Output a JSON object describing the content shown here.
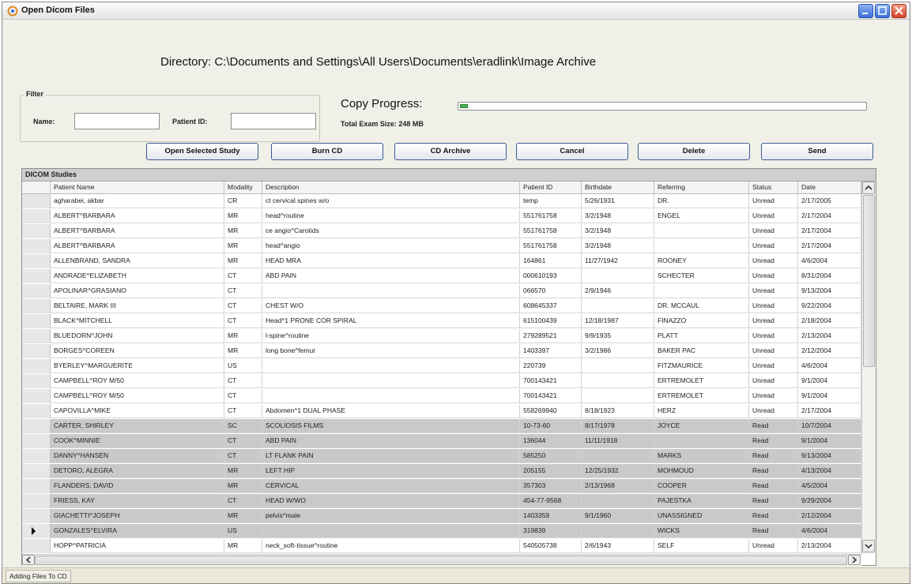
{
  "window": {
    "title": "Open Dicom Files"
  },
  "directory_text": "Directory: C:\\Documents and Settings\\All Users\\Documents\\eradlink\\Image Archive",
  "filter": {
    "legend": "Filter",
    "name_label": "Name:",
    "name_value": "",
    "patient_id_label": "Patient ID:",
    "patient_id_value": ""
  },
  "copy": {
    "label": "Copy Progress:",
    "progress": 0.01,
    "total_size": "Total Exam Size:  248 MB"
  },
  "buttons": [
    "Open Selected Study",
    "Burn CD",
    "CD Archive",
    "Cancel",
    "Delete",
    "Send"
  ],
  "table": {
    "title": "DICOM Studies",
    "columns": [
      "Patient Name",
      "Modality",
      "Description",
      "Patient ID",
      "Birthdate",
      "Referring",
      "Status",
      "Date"
    ],
    "rows": [
      [
        "agharabei, akbar",
        "CR",
        "ct cervical spines w/o",
        "temp",
        "5/26/1931",
        "DR.",
        "Unread",
        "2/17/2005",
        "unread"
      ],
      [
        "ALBERT^BARBARA",
        "MR",
        "head^routine",
        "551761758",
        "3/2/1948",
        "ENGEL",
        "Unread",
        "2/17/2004",
        "unread"
      ],
      [
        "ALBERT^BARBARA",
        "MR",
        "ce angio^Carotids",
        "551761758",
        "3/2/1948",
        "",
        "Unread",
        "2/17/2004",
        "unread"
      ],
      [
        "ALBERT^BARBARA",
        "MR",
        "head^angio",
        "551761758",
        "3/2/1948",
        "",
        "Unread",
        "2/17/2004",
        "unread"
      ],
      [
        "ALLENBRAND, SANDRA",
        "MR",
        "HEAD MRA",
        "164861",
        "11/27/1942",
        "ROONEY",
        "Unread",
        "4/6/2004",
        "unread"
      ],
      [
        "ANDRADE^ELIZABETH",
        "CT",
        "ABD PAIN",
        "000610193",
        "",
        "SCHECTER",
        "Unread",
        "8/31/2004",
        "unread"
      ],
      [
        "APOLINAR^GRASIANO",
        "CT",
        "",
        "066570",
        "2/9/1946",
        "",
        "Unread",
        "9/13/2004",
        "unread"
      ],
      [
        "BELTAIRE, MARK III",
        "CT",
        "CHEST W/O",
        "608645337",
        "",
        "DR. MCCAUL",
        "Unread",
        "9/22/2004",
        "unread"
      ],
      [
        "BLACK^MITCHELL",
        "CT",
        "Head^1 PRONE COR SPIRAL",
        "615100439",
        "12/18/1987",
        "FINAZZO",
        "Unread",
        "2/18/2004",
        "unread"
      ],
      [
        "BLUEDORN^JOHN",
        "MR",
        "l-spine^routine",
        "279289521",
        "9/9/1935",
        "PLATT",
        "Unread",
        "2/13/2004",
        "unread"
      ],
      [
        "BORGES^COREEN",
        "MR",
        "long bone^femur",
        "1403397",
        "3/2/1986",
        "BAKER PAC",
        "Unread",
        "2/12/2004",
        "unread"
      ],
      [
        "BYERLEY^MARGUERITE",
        "US",
        "",
        "220739",
        "",
        "FITZMAURICE",
        "Unread",
        "4/6/2004",
        "unread"
      ],
      [
        "CAMPBELL^ROY M/50",
        "CT",
        "",
        "700143421",
        "",
        "ERTREMOLET",
        "Unread",
        "9/1/2004",
        "unread"
      ],
      [
        "CAMPBELL^ROY M/50",
        "CT",
        "",
        "700143421",
        "",
        "ERTREMOLET",
        "Unread",
        "9/1/2004",
        "unread"
      ],
      [
        "CAPOVILLA^MIKE",
        "CT",
        "Abdomen^1 DUAL PHASE",
        "558269940",
        "8/18/1923",
        "HERZ",
        "Unread",
        "2/17/2004",
        "unread"
      ],
      [
        "CARTER, SHIRLEY",
        "SC",
        "SCOLIOSIS FILMS",
        "10-73-60",
        "8/17/1978",
        "JOYCE",
        "Read",
        "10/7/2004",
        "read"
      ],
      [
        "COOK^MINNIE",
        "CT",
        "ABD PAIN",
        "136044",
        "11/11/1918",
        "",
        "Read",
        "9/1/2004",
        "read"
      ],
      [
        "DANNY^HANSEN",
        "CT",
        "LT FLANK PAIN",
        "585250",
        "",
        "MARKS",
        "Read",
        "9/13/2004",
        "read"
      ],
      [
        "DETORO, ALEGRA",
        "MR",
        "LEFT HIP",
        "205155",
        "12/25/1932",
        "MOHMOUD",
        "Read",
        "4/13/2004",
        "read"
      ],
      [
        "FLANDERS, DAVID",
        "MR",
        "CERVICAL",
        "357303",
        "2/13/1968",
        "COOPER",
        "Read",
        "4/5/2004",
        "read"
      ],
      [
        "FRIESS, KAY",
        "CT",
        "HEAD W/WO",
        "454-77-9568",
        "",
        "PAJESTKA",
        "Read",
        "9/29/2004",
        "read"
      ],
      [
        "GIACHETTI^JOSEPH",
        "MR",
        "pelvis^male",
        "1403359",
        "9/1/1960",
        "UNASSIGNED",
        "Read",
        "2/12/2004",
        "read"
      ],
      [
        "GONZALES^ELVIRA",
        "US",
        "",
        "319839",
        "",
        "WICKS",
        "Read",
        "4/6/2004",
        "read"
      ],
      [
        "HOPP^PATRICIA",
        "MR",
        "neck_soft-tissue^routine",
        "540505738",
        "2/6/1943",
        "SELF",
        "Unread",
        "2/13/2004",
        "unread"
      ]
    ],
    "selected_row": 22
  },
  "status_bar": {
    "text": "Adding Files To CD"
  },
  "colors": {
    "read_row": "#c9c9c9",
    "unread_row": "#ffffff",
    "progress": "#47b34b"
  }
}
